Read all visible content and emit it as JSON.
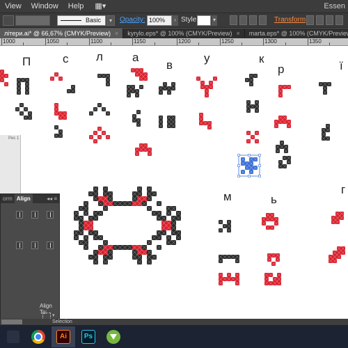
{
  "menubar": {
    "items": [
      "View",
      "Window",
      "Help"
    ],
    "workspace": "Essen"
  },
  "controlbar": {
    "stroke_profile": "Basic",
    "opacity_label": "Opacity:",
    "opacity_value": "100%",
    "style_label": "Style:",
    "transform_label": "Transform",
    "transform_color": "#ff8b3d",
    "opacity_link_color": "#4aa3ff"
  },
  "tabs": [
    {
      "label": "літери.ai* @ 66,67% (CMYK/Preview)",
      "close": "×",
      "active": true
    },
    {
      "label": "kyrylo.eps* @ 100% (CMYK/Preview)",
      "close": "×",
      "active": false
    },
    {
      "label": "marta.eps* @ 100% (CMYK/Preview)",
      "close": "×",
      "active": false
    }
  ],
  "ruler": {
    "labels": [
      "1000",
      "1050",
      "1100",
      "1150",
      "1200",
      "1250",
      "1300",
      "1350"
    ]
  },
  "canvas": {
    "glyphs": [
      "П",
      "с",
      "л",
      "а",
      "в",
      "у",
      "к",
      "р",
      "ї",
      "м",
      "ь",
      "г"
    ],
    "colors": {
      "red": "#d9202e",
      "black": "#2a2a2a",
      "selection": "#3a6fd8"
    }
  },
  "thumb": {
    "label": "Рис 1"
  },
  "align_panel": {
    "tab_transform": "orm",
    "tab_align": "Align",
    "controls": "◂◂  ≡",
    "align_to_label": "Align To:",
    "align_to_dropdown": "▾"
  },
  "status": {
    "text": "Selection"
  },
  "taskbar": {
    "apps": [
      {
        "name": "start"
      },
      {
        "name": "chrome"
      },
      {
        "name": "illustrator",
        "label": "Ai",
        "active": true
      },
      {
        "name": "photoshop",
        "label": "Ps"
      },
      {
        "name": "utorrent"
      }
    ]
  }
}
